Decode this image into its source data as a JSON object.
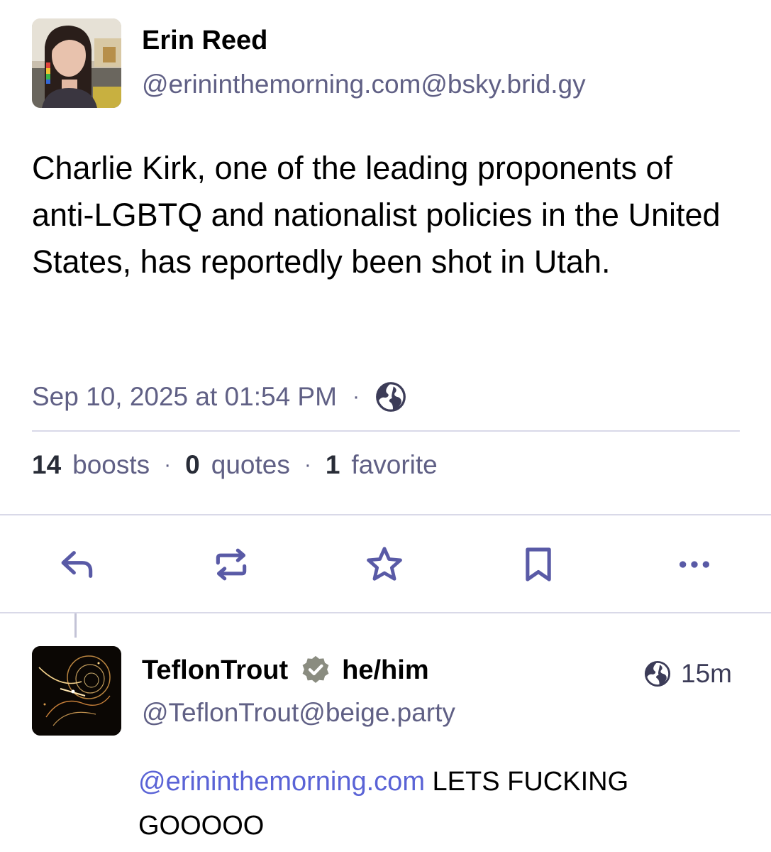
{
  "post": {
    "author_name": "Erin Reed",
    "author_handle": "@erininthemorning.com@bsky.brid.gy",
    "text": "Charlie Kirk, one of the leading proponents of anti-LGBTQ and nationalist policies in the United States, has reportedly been shot in Utah.",
    "timestamp": "Sep 10, 2025 at 01:54 PM",
    "separator": "·",
    "visibility_icon": "globe-icon"
  },
  "stats": {
    "boosts_count": "14",
    "boosts_label": "boosts",
    "quotes_count": "0",
    "quotes_label": "quotes",
    "favorites_count": "1",
    "favorites_label": "favorite",
    "separator": "·"
  },
  "actions": {
    "icons": [
      "reply-icon",
      "boost-icon",
      "star-icon",
      "bookmark-icon",
      "more-icon"
    ]
  },
  "reply": {
    "author_name": "TeflonTrout",
    "pronouns": "he/him",
    "author_handle": "@TeflonTrout@beige.party",
    "time": "15m",
    "mention": "@erininthemorning.com",
    "text": " LETS FUCKING GOOOOO",
    "visibility_icon": "globe-icon"
  },
  "colors": {
    "icon": "#595aa6",
    "secondary_text": "#606085",
    "link": "#5a63d6",
    "divider": "#d9d9e8",
    "verified_badge": "#8a8c80"
  }
}
